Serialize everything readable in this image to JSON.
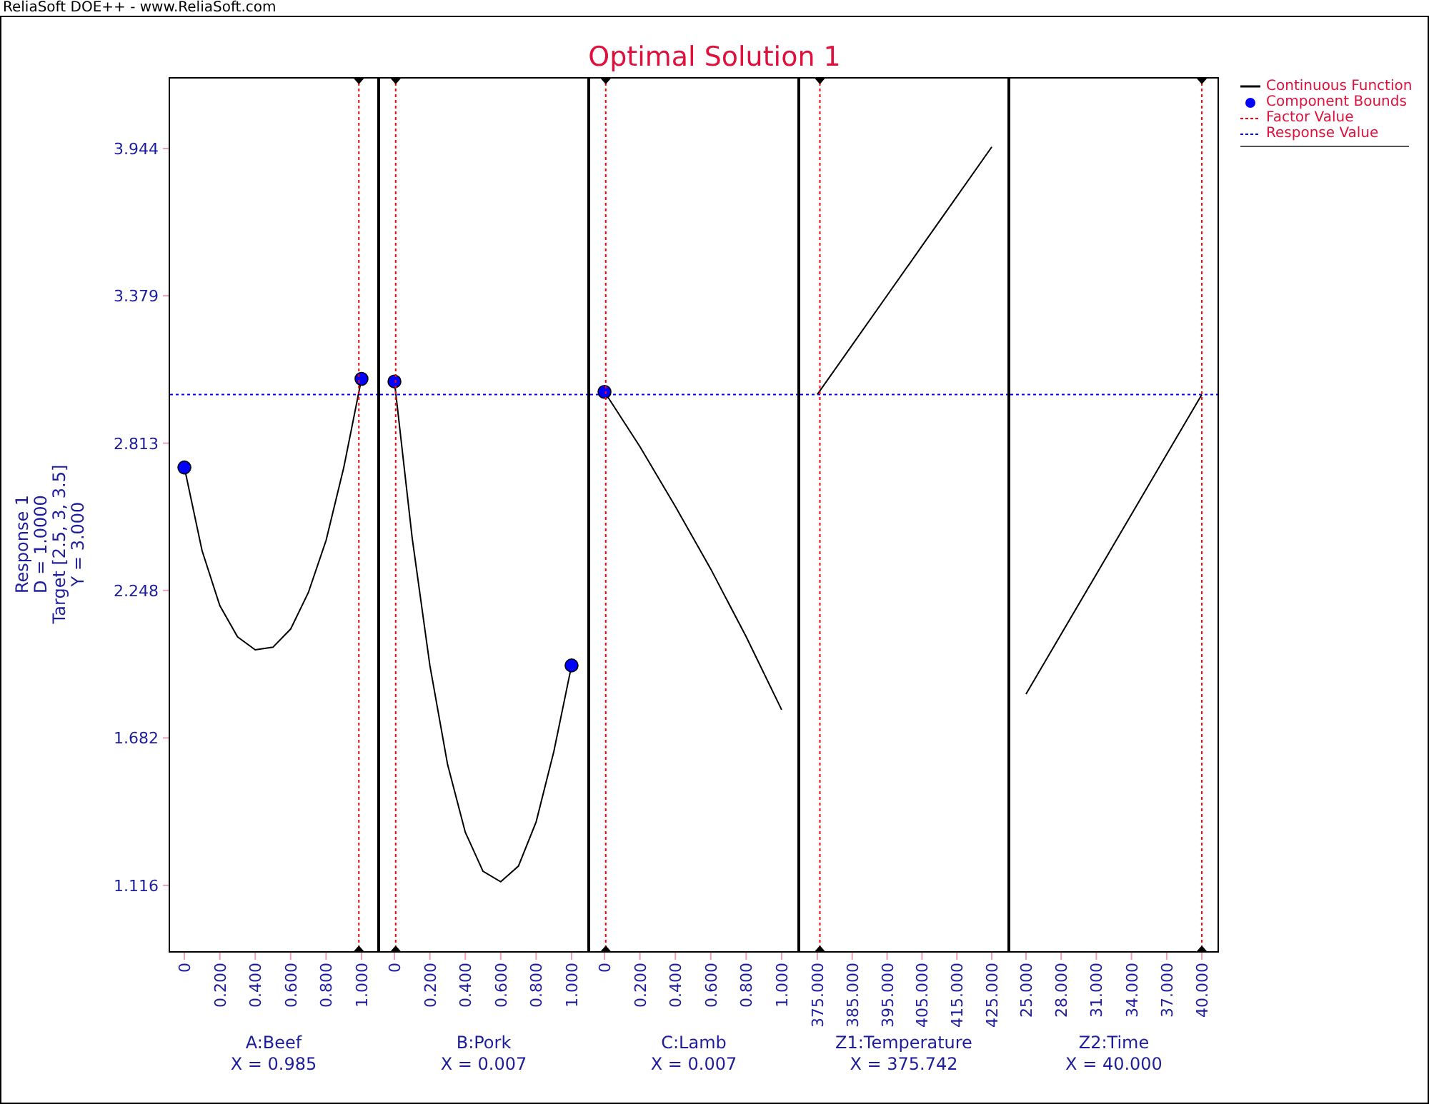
{
  "title_bar": "ReliaSoft DOE++ - www.ReliaSoft.com",
  "chart_title": "Optimal Solution 1",
  "response_label": [
    "Response 1",
    "D = 1.0000",
    "Target [2.5, 3, 3.5]",
    "Y = 3.000"
  ],
  "panels": [
    {
      "setting": "X = 0.985",
      "chart_data": {
        "type": "line",
        "xlabel": "A:Beef",
        "x": [
          0,
          0.1,
          0.2,
          0.3,
          0.4,
          0.5,
          0.6,
          0.7,
          0.8,
          0.9,
          1
        ],
        "series": [
          {
            "color": "#000000",
            "values": [
              2.72,
              2.4,
              2.19,
              2.07,
              2.02,
              2.03,
              2.1,
              2.24,
              2.44,
              2.72,
              3.06
            ]
          },
          {
            "color": "#0000ff",
            "marker": "circle",
            "values": [
              2.72,
              null,
              null,
              null,
              null,
              null,
              null,
              null,
              null,
              null,
              3.06
            ]
          }
        ],
        "xlim": [
          -0.089,
          1.097
        ],
        "ylim": [
          0.858,
          4.218
        ],
        "xticks": [
          {
            "value": 0,
            "label": "0"
          },
          {
            "value": 0.2,
            "label": "0.200"
          },
          {
            "value": 0.4,
            "label": "0.400"
          },
          {
            "value": 0.6,
            "label": "0.600"
          },
          {
            "value": 0.8,
            "label": "0.800"
          },
          {
            "value": 1,
            "label": "1.000"
          }
        ],
        "yticks": [
          1.116,
          1.682,
          2.248,
          2.813,
          3.379,
          3.944
        ],
        "ref_lines": [
          {
            "axis": "x",
            "value": 0.985,
            "color": "#ff0000"
          },
          {
            "axis": "y",
            "value": 3.0,
            "color": "#0000ff"
          }
        ]
      }
    },
    {
      "setting": "X = 0.007",
      "chart_data": {
        "type": "line",
        "xlabel": "B:Pork",
        "x": [
          0,
          0.1,
          0.2,
          0.3,
          0.4,
          0.5,
          0.6,
          0.7,
          0.8,
          0.9,
          1
        ],
        "series": [
          {
            "color": "#000000",
            "values": [
              3.05,
              2.45,
              1.96,
              1.58,
              1.32,
              1.17,
              1.13,
              1.19,
              1.36,
              1.63,
              1.96
            ]
          },
          {
            "color": "#0000ff",
            "marker": "circle",
            "values": [
              3.05,
              null,
              null,
              null,
              null,
              null,
              null,
              null,
              null,
              null,
              1.96
            ]
          }
        ],
        "xlim": [
          -0.089,
          1.097
        ],
        "ylim": [
          0.858,
          4.218
        ],
        "xticks": [
          {
            "value": 0,
            "label": "0"
          },
          {
            "value": 0.2,
            "label": "0.200"
          },
          {
            "value": 0.4,
            "label": "0.400"
          },
          {
            "value": 0.6,
            "label": "0.600"
          },
          {
            "value": 0.8,
            "label": "0.800"
          },
          {
            "value": 1,
            "label": "1.000"
          }
        ],
        "ref_lines": [
          {
            "axis": "x",
            "value": 0.007,
            "color": "#ff0000"
          },
          {
            "axis": "y",
            "value": 3.0,
            "color": "#0000ff"
          }
        ]
      }
    },
    {
      "setting": "X = 0.007",
      "chart_data": {
        "type": "line",
        "xlabel": "C:Lamb",
        "x": [
          0,
          0.2,
          0.4,
          0.6,
          0.8,
          1
        ],
        "series": [
          {
            "color": "#000000",
            "values": [
              3.01,
              2.8,
              2.57,
              2.33,
              2.07,
              1.79
            ]
          },
          {
            "color": "#0000ff",
            "marker": "circle",
            "values": [
              3.01,
              null,
              null,
              null,
              null,
              null
            ]
          }
        ],
        "xlim": [
          -0.089,
          1.097
        ],
        "ylim": [
          0.858,
          4.218
        ],
        "xticks": [
          {
            "value": 0,
            "label": "0"
          },
          {
            "value": 0.2,
            "label": "0.200"
          },
          {
            "value": 0.4,
            "label": "0.400"
          },
          {
            "value": 0.6,
            "label": "0.600"
          },
          {
            "value": 0.8,
            "label": "0.800"
          },
          {
            "value": 1,
            "label": "1.000"
          }
        ],
        "ref_lines": [
          {
            "axis": "x",
            "value": 0.007,
            "color": "#ff0000"
          },
          {
            "axis": "y",
            "value": 3.0,
            "color": "#0000ff"
          }
        ]
      }
    },
    {
      "setting": "X = 375.742",
      "chart_data": {
        "type": "line",
        "xlabel": "Z1:Temperature",
        "x": [
          375,
          385,
          395,
          405,
          415,
          425
        ],
        "series": [
          {
            "color": "#000000",
            "values": [
              3.0,
              3.19,
              3.38,
              3.57,
              3.76,
              3.95
            ]
          }
        ],
        "xlim": [
          369.7,
          429.9
        ],
        "ylim": [
          0.858,
          4.218
        ],
        "xticks": [
          {
            "value": 375,
            "label": "375.000"
          },
          {
            "value": 385,
            "label": "385.000"
          },
          {
            "value": 395,
            "label": "395.000"
          },
          {
            "value": 405,
            "label": "405.000"
          },
          {
            "value": 415,
            "label": "415.000"
          },
          {
            "value": 425,
            "label": "425.000"
          }
        ],
        "ref_lines": [
          {
            "axis": "x",
            "value": 375.742,
            "color": "#ff0000"
          },
          {
            "axis": "y",
            "value": 3.0,
            "color": "#0000ff"
          }
        ]
      }
    },
    {
      "setting": "X = 40.000",
      "chart_data": {
        "type": "line",
        "xlabel": "Z2:Time",
        "x": [
          25,
          28,
          31,
          34,
          37,
          40
        ],
        "series": [
          {
            "color": "#000000",
            "values": [
              1.85,
              2.08,
              2.31,
              2.54,
              2.77,
              3.0
            ]
          }
        ],
        "xlim": [
          23.54,
          41.46
        ],
        "ylim": [
          0.858,
          4.218
        ],
        "xticks": [
          {
            "value": 25,
            "label": "25.000"
          },
          {
            "value": 28,
            "label": "28.000"
          },
          {
            "value": 31,
            "label": "31.000"
          },
          {
            "value": 34,
            "label": "34.000"
          },
          {
            "value": 37,
            "label": "37.000"
          },
          {
            "value": 40,
            "label": "40.000"
          }
        ],
        "ref_lines": [
          {
            "axis": "x",
            "value": 40.0,
            "color": "#ff0000"
          },
          {
            "axis": "y",
            "value": 3.0,
            "color": "#0000ff"
          }
        ]
      }
    }
  ],
  "legend": [
    {
      "kind": "line",
      "label": "Continuous Function",
      "color": "#000000"
    },
    {
      "kind": "dot",
      "label": "Component Bounds",
      "color": "#0000ff"
    },
    {
      "kind": "dash",
      "label": "Factor Value",
      "color": "#ff0000"
    },
    {
      "kind": "dash",
      "label": "Response Value",
      "color": "#0000ff"
    }
  ]
}
